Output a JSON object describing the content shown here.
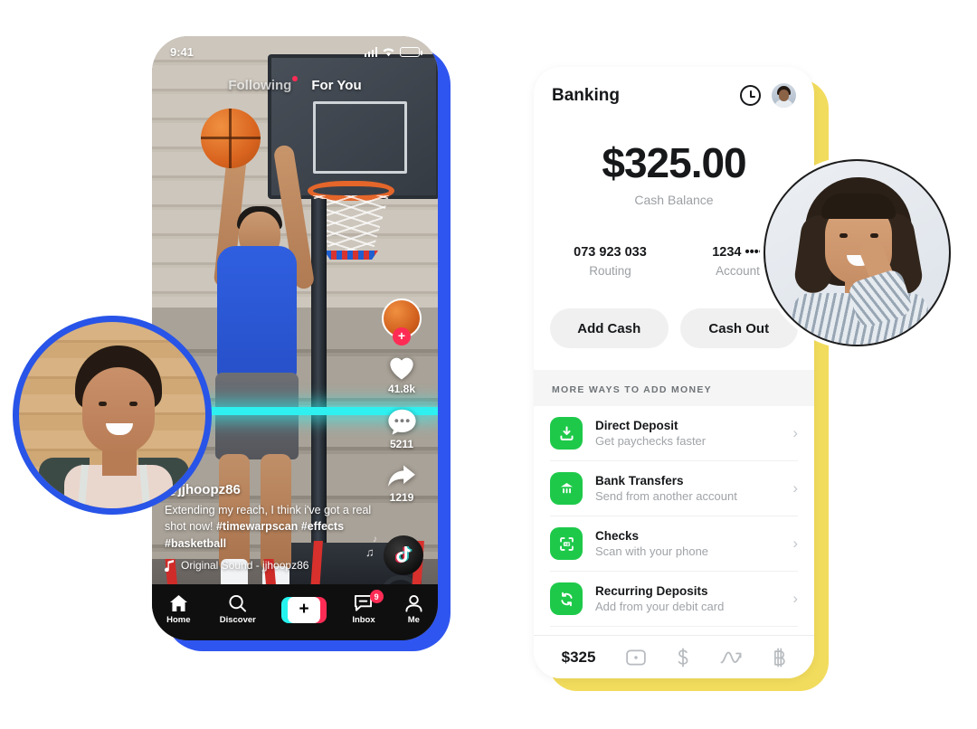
{
  "tiktok": {
    "status_bar": {
      "time": "9:41",
      "signal_icon": "signal-bars-icon",
      "wifi_icon": "wifi-icon",
      "battery_icon": "battery-icon"
    },
    "feed_tabs": [
      {
        "label": "Following",
        "active": false,
        "has_dot": true
      },
      {
        "label": "For You",
        "active": true,
        "has_dot": false
      }
    ],
    "rail": {
      "avatar_icon": "basketball-avatar-icon",
      "follow_label": "+",
      "actions": [
        {
          "icon": "heart-icon",
          "count": "41.8k"
        },
        {
          "icon": "comment-icon",
          "count": "5211"
        },
        {
          "icon": "share-arrow-icon",
          "count": "1219"
        }
      ]
    },
    "caption": {
      "username": "@jjhoopz86",
      "text_part1": "Extending my reach, I think i've got a real shot now! ",
      "hashtags1": "#timewarpscan #effects",
      "hashtags2": "#basketball",
      "music_icon": "music-note-icon",
      "music_label": "Original Sound - jjhoopz86",
      "disc_icon": "tiktok-note-disc-icon"
    },
    "nav": [
      {
        "icon": "home-icon",
        "label": "Home",
        "badge": ""
      },
      {
        "icon": "search-icon",
        "label": "Discover",
        "badge": ""
      },
      {
        "icon": "plus-create-icon",
        "label": "",
        "badge": ""
      },
      {
        "icon": "inbox-icon",
        "label": "Inbox",
        "badge": "9"
      },
      {
        "icon": "person-icon",
        "label": "Me",
        "badge": ""
      }
    ],
    "colors": {
      "frame": "#2f55f0",
      "accent_red": "#fe2c55",
      "accent_cyan": "#25f4ee",
      "scanline": "#2ef0f0"
    }
  },
  "cashapp": {
    "header": {
      "title": "Banking",
      "clock_icon": "clock-icon",
      "avatar_icon": "profile-avatar-icon"
    },
    "balance": {
      "amount": "$325.00",
      "label": "Cash Balance"
    },
    "account_details": [
      {
        "value": "073 923 033",
        "label": "Routing"
      },
      {
        "value": "1234 ••••",
        "label": "Account"
      }
    ],
    "buttons": [
      {
        "label": "Add Cash"
      },
      {
        "label": "Cash Out"
      }
    ],
    "section_header": "MORE WAYS TO ADD MONEY",
    "money_rows": [
      {
        "icon": "download-deposit-icon",
        "title": "Direct Deposit",
        "subtitle": "Get paychecks faster",
        "chevron": "chevron-right-icon"
      },
      {
        "icon": "bank-building-icon",
        "title": "Bank Transfers",
        "subtitle": "Send from another account",
        "chevron": "chevron-right-icon"
      },
      {
        "icon": "check-scan-icon",
        "title": "Checks",
        "subtitle": "Scan with your phone",
        "chevron": "chevron-right-icon"
      },
      {
        "icon": "recurring-refresh-icon",
        "title": "Recurring Deposits",
        "subtitle": "Add from your debit card",
        "chevron": "chevron-right-icon"
      }
    ],
    "tabbar": [
      {
        "icon": "money-amount",
        "label": "$325"
      },
      {
        "icon": "card-icon",
        "label": ""
      },
      {
        "icon": "dollar-icon",
        "label": ""
      },
      {
        "icon": "stocks-chart-icon",
        "label": ""
      },
      {
        "icon": "bitcoin-icon",
        "label": ""
      }
    ],
    "colors": {
      "frame": "#f2dc5d",
      "icon_green": "#1ec94a",
      "card": "#ffffff"
    }
  },
  "avatars": {
    "left": {
      "name": "person-avatar-left",
      "ring_color": "#2854e8"
    },
    "right": {
      "name": "person-avatar-right",
      "ring_color": "#1c1c1c"
    }
  }
}
